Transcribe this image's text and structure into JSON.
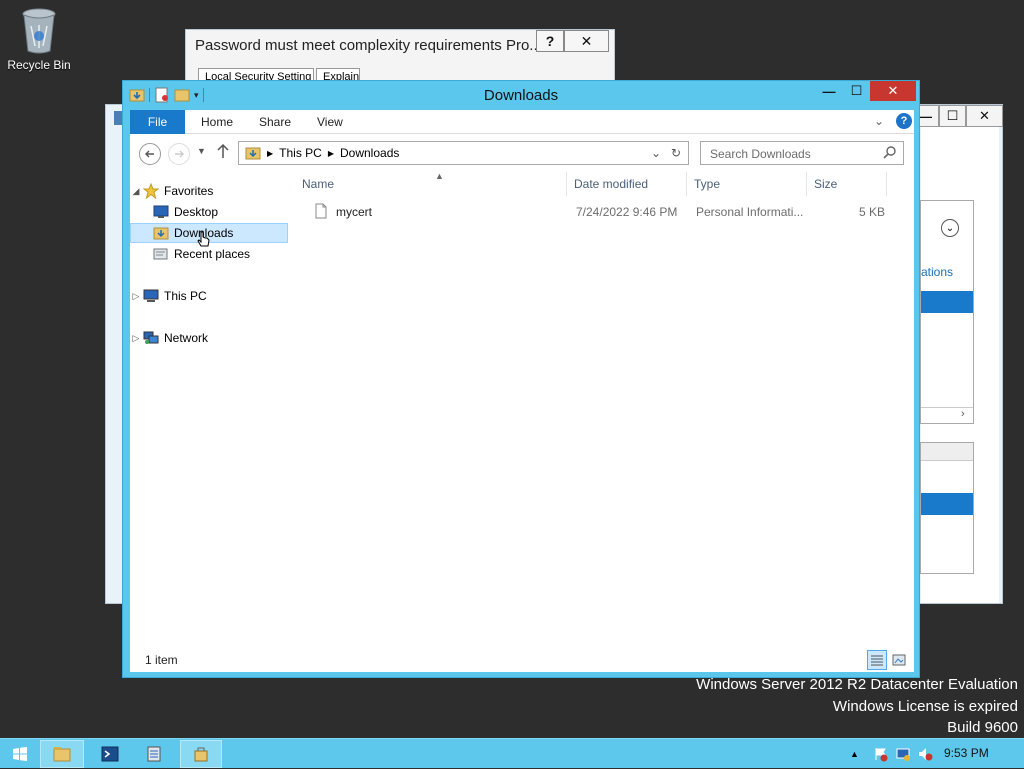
{
  "desktop": {
    "recycle_bin_label": "Recycle Bin",
    "watermark": [
      "Windows Server 2012 R2 Datacenter Evaluation",
      "Windows License is expired",
      "Build 9600"
    ]
  },
  "password_dialog": {
    "title": "Password must meet complexity requirements Pro...",
    "help_label": "?",
    "close_label": "✕",
    "tabs": [
      "Local Security Setting",
      "Explain"
    ]
  },
  "background_window": {
    "link_text": "ations",
    "min_label": "—",
    "max_label": "☐",
    "close_label": "✕"
  },
  "explorer": {
    "title": "Downloads",
    "window_controls": {
      "min": "—",
      "max": "☐",
      "close": "✕"
    },
    "ribbon": {
      "file_tab": "File",
      "tabs": [
        "Home",
        "Share",
        "View"
      ],
      "help": "?"
    },
    "address": {
      "crumbs": [
        "This PC",
        "Downloads"
      ]
    },
    "search_placeholder": "Search Downloads",
    "nav_tree": {
      "favorites": "Favorites",
      "desktop": "Desktop",
      "downloads": "Downloads",
      "recent": "Recent places",
      "this_pc": "This PC",
      "network": "Network"
    },
    "columns": [
      "Name",
      "Date modified",
      "Type",
      "Size"
    ],
    "files": [
      {
        "name": "mycert",
        "date": "7/24/2022 9:46 PM",
        "type": "Personal Informati...",
        "size": "5 KB"
      }
    ],
    "status": "1 item"
  },
  "taskbar": {
    "clock": "9:53 PM"
  },
  "colors": {
    "window_frame": "#5bc7ec",
    "file_tab": "#1979ca",
    "selection": "#cce8ff",
    "close_button": "#c7372f",
    "taskbar": "#5dc8ec",
    "desktop": "#2d2d2d"
  }
}
